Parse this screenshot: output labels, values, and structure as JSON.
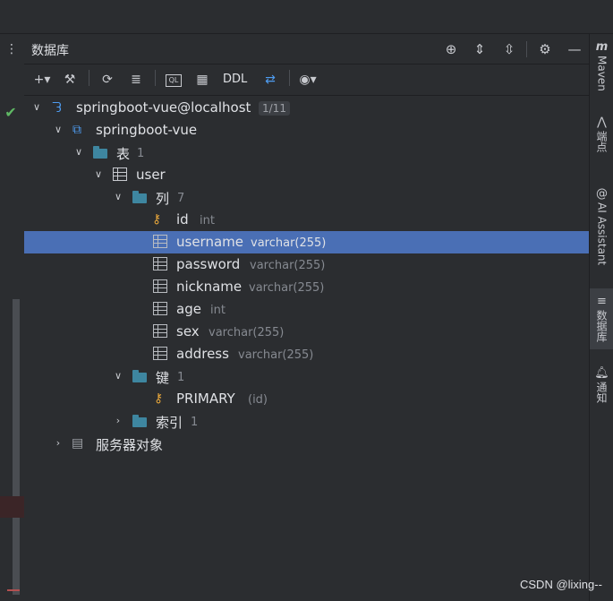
{
  "panel": {
    "title": "数据库"
  },
  "toolbar": {
    "ddl_label": "DDL",
    "ql_label": "QL"
  },
  "tree": {
    "datasource": {
      "label": "springboot-vue@localhost",
      "badge": "1/11"
    },
    "schema": {
      "label": "springboot-vue"
    },
    "tables_folder": {
      "label": "表",
      "count": "1"
    },
    "table": {
      "label": "user"
    },
    "columns_folder": {
      "label": "列",
      "count": "7"
    },
    "columns": [
      {
        "name": "id",
        "type": "int"
      },
      {
        "name": "username",
        "type": "varchar(255)"
      },
      {
        "name": "password",
        "type": "varchar(255)"
      },
      {
        "name": "nickname",
        "type": "varchar(255)"
      },
      {
        "name": "age",
        "type": "int"
      },
      {
        "name": "sex",
        "type": "varchar(255)"
      },
      {
        "name": "address",
        "type": "varchar(255)"
      }
    ],
    "keys_folder": {
      "label": "键",
      "count": "1"
    },
    "key": {
      "label": "PRIMARY",
      "detail": "(id)"
    },
    "index_folder": {
      "label": "索引",
      "count": "1"
    },
    "server_objects": {
      "label": "服务器对象"
    }
  },
  "right_sidebar": {
    "maven": "Maven",
    "endpoints": "端点",
    "ai_assistant": "AI Assistant",
    "database": "数据库",
    "notifications": "通知"
  },
  "watermark": "CSDN @lixing--"
}
